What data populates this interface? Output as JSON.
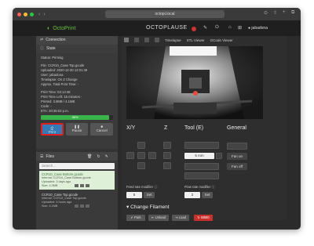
{
  "browser": {
    "url": "octopi.local"
  },
  "navbar": {
    "brand": "OctoPrint",
    "printer_name": "OCTOPLAUSE",
    "user": "jabadona"
  },
  "state_panel": {
    "header": "Connection",
    "sub_header": "State",
    "status": "Status: Printing",
    "file": "File: CCR10_Case Top.gcode",
    "uploaded": "Uploaded: 2020-12-30 12:01:49",
    "user": "User: jabadona",
    "timelapse": "Timelapse: On Z Change",
    "approx_total": "Approx. Total Print Time: -",
    "print_time": "Print Time: 04:13:48",
    "print_time_left": "Print Time Left: 15 minutes -",
    "printed": "Printed: 3.8MB / 4.1MB",
    "code": "Code: -",
    "eta": "ETA: 20:35:03 p.m.",
    "progress_label": "95%",
    "progress_value": 95,
    "buttons": {
      "print": "Print",
      "pause": "Pause",
      "cancel": "Cancel"
    }
  },
  "files_panel": {
    "header": "Files",
    "search_placeholder": "Search...",
    "files": [
      {
        "name": "CCR10_Case Bottom.gcode",
        "location": "Internal: CCR10_Case Bottom.gcode",
        "uploaded": "Uploaded: 3 days ago",
        "size": "Size: 4.3MB"
      },
      {
        "name": "CCR10_Case Top.gcode",
        "location": "Internal: CCR10_Case Top.gcode",
        "uploaded": "Uploaded: 4 hours ago",
        "size": "Size: 4.1MB"
      }
    ]
  },
  "tabs": [
    "Timelapse",
    "STL Viewer",
    "GCode Viewer"
  ],
  "controls": {
    "xy_label": "X/Y",
    "z_label": "Z",
    "tool_label": "Tool (E)",
    "general_label": "General",
    "extrude_value": "5",
    "extrude_unit": "mm",
    "fan_on": "Fan on",
    "fan_off": "Fan off",
    "feed_rate_label": "Feed rate modifier",
    "feed_rate_value": "5",
    "feed_rate_set": "Set",
    "flow_rate_label": "Flow rate modifier",
    "flow_rate_value": "2",
    "flow_rate_set": "Set"
  },
  "filament": {
    "header": "Change Filament",
    "buttons": [
      "Park",
      "Unload",
      "Load",
      "M600"
    ]
  }
}
